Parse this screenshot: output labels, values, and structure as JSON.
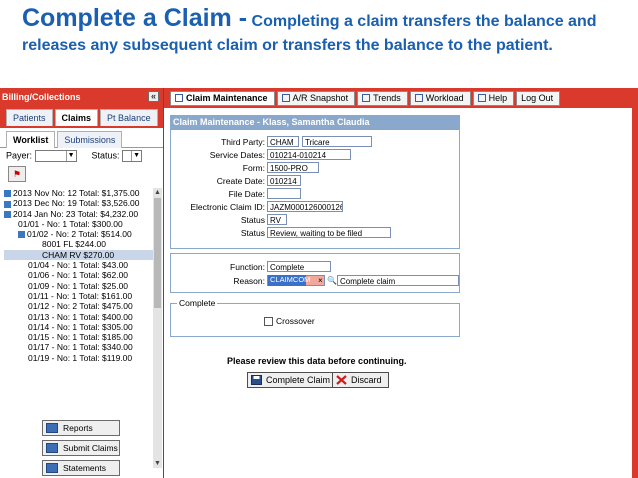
{
  "slide": {
    "title": "Complete a Claim -",
    "subtitle": "Completing a claim transfers the balance and releases any subsequent claim or transfers the balance to the patient."
  },
  "left": {
    "panel_title": "Billing/Collections",
    "collapse_glyph": "«",
    "tabs": [
      "Patients",
      "Claims",
      "Pt Balance"
    ],
    "active_tab": "Claims",
    "subtabs": [
      "Worklist",
      "Submissions"
    ],
    "active_subtab": "Worklist",
    "payer_label": "Payer:",
    "status_label": "Status:",
    "tree": [
      "2013 Nov No: 12 Total: $1,375.00",
      "2013 Dec No: 19 Total: $3,526.00",
      "2014 Jan No: 23 Total: $4,232.00",
      "01/01 - No: 1 Total: $300.00",
      "01/02 - No: 2 Total: $514.00",
      "8001 FL $244.00",
      "CHAM RV $270.00",
      "01/04 - No: 1 Total: $43.00",
      "01/06 - No: 1 Total: $62.00",
      "01/09 - No: 1 Total: $25.00",
      "01/11 - No: 1 Total: $161.00",
      "01/12 - No: 2 Total: $475.00",
      "01/13 - No: 1 Total: $400.00",
      "01/14 - No: 1 Total: $305.00",
      "01/15 - No: 1 Total: $185.00",
      "01/17 - No: 1 Total: $340.00",
      "01/19 - No: 1 Total: $119.00"
    ],
    "buttons": [
      "Reports",
      "Submit Claims",
      "Statements"
    ]
  },
  "nav": {
    "items": [
      "Claim Maintenance",
      "A/R Snapshot",
      "Trends",
      "Workload",
      "Help",
      "Log Out"
    ],
    "active": "Claim Maintenance"
  },
  "claim": {
    "header": "Claim Maintenance - Klass, Samantha Claudia",
    "third_party_label": "Third Party:",
    "third_party_code": "CHAM",
    "third_party_name": "Tricare",
    "service_dates_label": "Service Dates:",
    "service_dates": "010214-010214",
    "form_label": "Form:",
    "form": "1500-PRO",
    "create_date_label": "Create Date:",
    "create_date": "010214",
    "file_date_label": "File Date:",
    "file_date": "",
    "electronic_id_label": "Electronic Claim ID:",
    "electronic_id": "JAZM000126000126",
    "status1_label": "Status",
    "status1": "RV",
    "status2_label": "Status",
    "status2": "Review, waiting to be filed",
    "function_label": "Function:",
    "function": "Complete",
    "reason_label": "Reason:",
    "reason_code": "CLAIMCOM",
    "reason_text": "Complete claim",
    "fieldset_legend": "Complete",
    "crossover_label": "Crossover",
    "notice": "Please review this data before continuing.",
    "complete_button": "Complete Claim",
    "discard_button": "Discard"
  },
  "colors": {
    "accent_red": "#d93a2b",
    "title_blue": "#1a5fb0",
    "panel_blue": "#8aa8cc"
  }
}
